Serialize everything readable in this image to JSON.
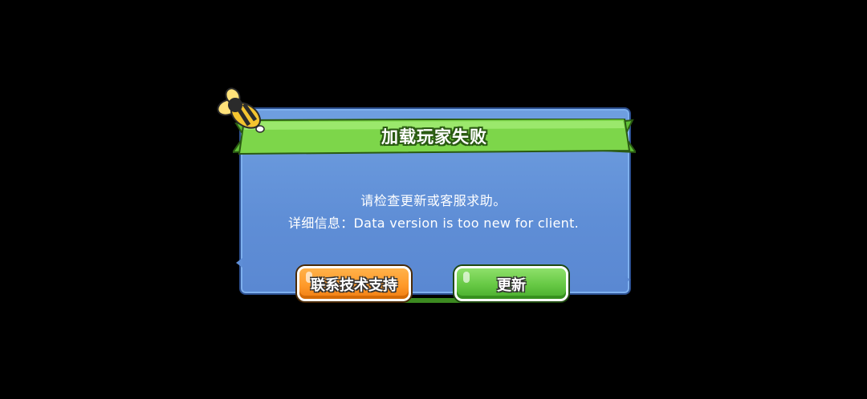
{
  "dialog": {
    "title": "加载玩家失败",
    "message_line1": "请检查更新或客服求助。",
    "message_line2": "详细信息：Data version is too new for client.",
    "icon": "bee-icon"
  },
  "buttons": {
    "support_label": "联系技术支持",
    "update_label": "更新"
  },
  "colors": {
    "background": "#000000",
    "panel": "#6f9fe0",
    "ribbon": "#7dd64a",
    "support_button": "#ff9a2a",
    "update_button": "#66c844"
  }
}
